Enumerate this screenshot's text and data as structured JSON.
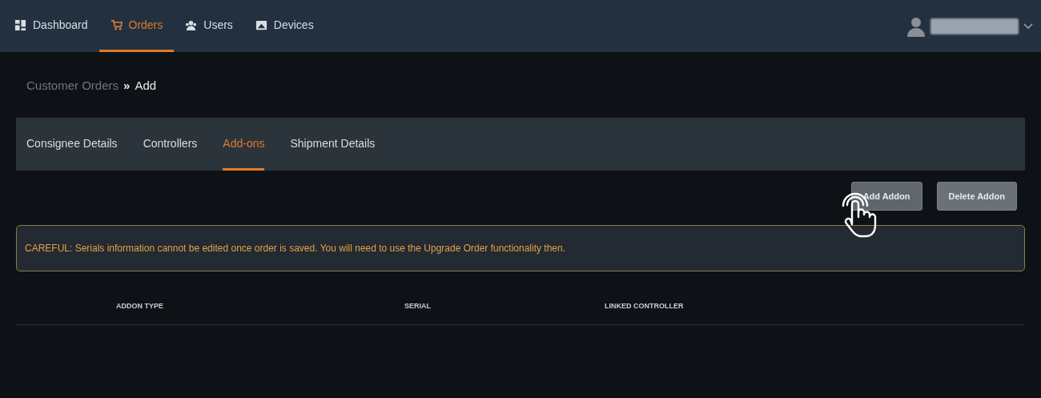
{
  "nav": {
    "items": [
      {
        "label": "Dashboard",
        "selected": false
      },
      {
        "label": "Orders",
        "selected": true
      },
      {
        "label": "Users",
        "selected": false
      },
      {
        "label": "Devices",
        "selected": false
      }
    ]
  },
  "breadcrumb": {
    "parent": "Customer Orders",
    "separator": "»",
    "current": "Add"
  },
  "tabs": [
    {
      "label": "Consignee Details",
      "selected": false
    },
    {
      "label": "Controllers",
      "selected": false
    },
    {
      "label": "Add-ons",
      "selected": true
    },
    {
      "label": "Shipment Details",
      "selected": false
    }
  ],
  "buttons": [
    "Add Addon",
    "Delete Addon"
  ],
  "warning": "CAREFUL: Serials information cannot be edited once order is saved. You will need to use the Upgrade Order functionality then.",
  "table": {
    "columns": [
      "ADDON TYPE",
      "SERIAL",
      "LINKED CONTROLLER"
    ]
  }
}
